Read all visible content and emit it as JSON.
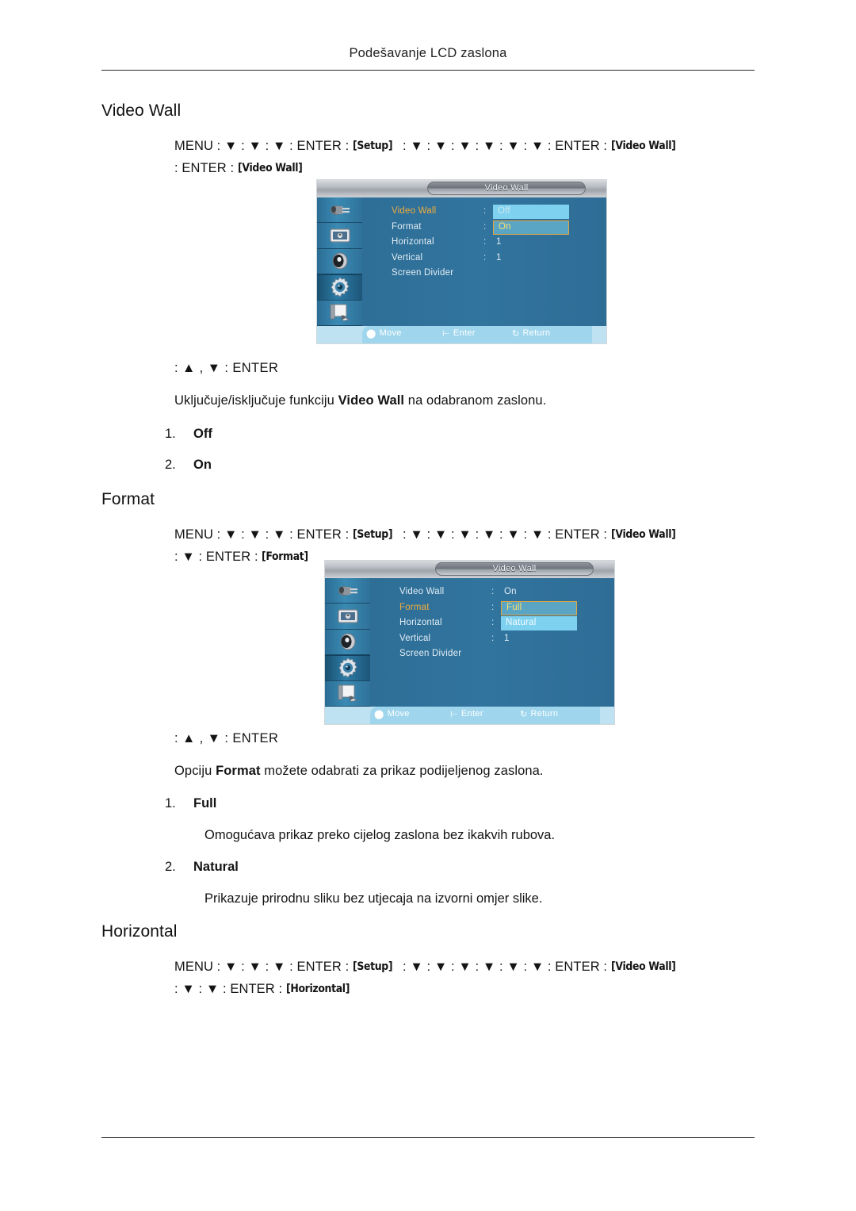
{
  "page": {
    "header_title": "Podešavanje LCD zaslona"
  },
  "sections": [
    {
      "id": "video-wall",
      "heading": "Video Wall",
      "navpath": {
        "line1": "MENU : ▼ : ▼ : ▼ : ENTER : ",
        "tag1": "[Setup]",
        "mid": " : ▼ : ▼ : ▼ : ▼ : ▼ : ▼ : ENTER : ",
        "tag2": "[Video Wall]",
        "line2_pre": " : ENTER : ",
        "tag3": "[Video Wall]"
      },
      "enter_line": ": ▲ , ▼ : ENTER",
      "description_pre": "Uključuje/isključuje funkciju ",
      "description_bold": "Video Wall",
      "description_post": " na odabranom zaslonu.",
      "options": [
        {
          "num": "1.",
          "label": "Off",
          "desc": ""
        },
        {
          "num": "2.",
          "label": "On",
          "desc": ""
        }
      ]
    },
    {
      "id": "format",
      "heading": "Format",
      "navpath": {
        "line1": "MENU : ▼ : ▼ : ▼ : ENTER : ",
        "tag1": "[Setup]",
        "mid": " : ▼ : ▼ : ▼ : ▼ : ▼ : ▼ : ENTER : ",
        "tag2": "[Video Wall]",
        "line2_pre": " : ▼ : ENTER : ",
        "tag3": "[Format]"
      },
      "enter_line": ": ▲ , ▼ : ENTER",
      "description_pre": "Opciju ",
      "description_bold": "Format",
      "description_post": " možete odabrati za prikaz podijeljenog zaslona.",
      "options": [
        {
          "num": "1.",
          "label": "Full",
          "desc": "Omogućava prikaz preko cijelog zaslona bez ikakvih rubova."
        },
        {
          "num": "2.",
          "label": "Natural",
          "desc": "Prikazuje prirodnu sliku bez utjecaja na izvorni omjer slike."
        }
      ]
    },
    {
      "id": "horizontal",
      "heading": "Horizontal",
      "navpath": {
        "line1": "MENU : ▼ : ▼ : ▼ : ENTER : ",
        "tag1": "[Setup]",
        "mid": " : ▼ : ▼ : ▼ : ▼ : ▼ : ▼ : ENTER : ",
        "tag2": "[Video Wall]",
        "line2_pre": " : ▼ : ▼ : ENTER : ",
        "tag3": "[Horizontal]"
      }
    }
  ],
  "osd1": {
    "title": "Video Wall",
    "rows": [
      {
        "label": "Video Wall",
        "highlight": true,
        "colon": ":",
        "chip": "Off",
        "chip_style": "plain"
      },
      {
        "label": "Format",
        "highlight": false,
        "colon": ":",
        "chip": "On",
        "chip_style": "selected"
      },
      {
        "label": "Horizontal",
        "highlight": false,
        "colon": ":",
        "value": "1"
      },
      {
        "label": "Vertical",
        "highlight": false,
        "colon": ":",
        "value": "1"
      },
      {
        "label": "Screen Divider",
        "highlight": false,
        "colon": "",
        "value": ""
      }
    ],
    "footer": {
      "move": "Move",
      "enter": "Enter",
      "return": "Return"
    }
  },
  "osd2": {
    "title": "Video Wall",
    "rows": [
      {
        "label": "Video Wall",
        "highlight": false,
        "colon": ":",
        "value": "On"
      },
      {
        "label": "Format",
        "highlight": true,
        "colon": ":",
        "chip": "Full",
        "chip_style": "selected"
      },
      {
        "label": "Horizontal",
        "highlight": false,
        "colon": ":",
        "chip": "Natural",
        "chip_style": "natural"
      },
      {
        "label": "Vertical",
        "highlight": false,
        "colon": ":",
        "value": "1"
      },
      {
        "label": "Screen Divider",
        "highlight": false,
        "colon": "",
        "value": ""
      }
    ],
    "footer": {
      "move": "Move",
      "enter": "Enter",
      "return": "Return"
    }
  },
  "osd_icons": [
    "input-source-icon",
    "picture-icon",
    "sound-speaker-icon",
    "setup-gear-icon",
    "multi-control-icon"
  ],
  "colors": {
    "osd_background": "#2e6d96",
    "highlight_label": "#f0ac3c",
    "chip_plain": "#7ed2ef",
    "chip_selected_border": "#e2a63f",
    "chip_selected_text": "#ffdf6b",
    "footer_bar": "#9fd6ed"
  }
}
